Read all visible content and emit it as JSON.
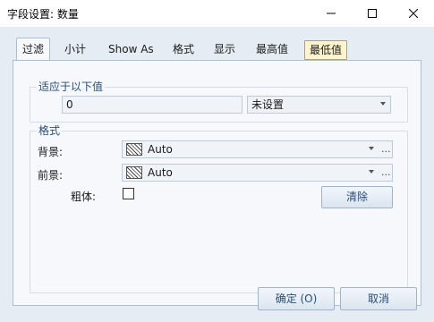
{
  "window": {
    "title": "字段设置: 数量"
  },
  "tabs": [
    {
      "label": "过滤"
    },
    {
      "label": "小计"
    },
    {
      "label": "Show As"
    },
    {
      "label": "格式"
    },
    {
      "label": "显示"
    },
    {
      "label": "最高值"
    },
    {
      "label": "最低值"
    }
  ],
  "selected_tab": "最低值",
  "apply_group": {
    "legend": "适应于以下值",
    "value_input": "0",
    "condition_select": "未设置"
  },
  "format_group": {
    "legend": "格式",
    "background_label": "背景:",
    "background_value": "Auto",
    "foreground_label": "前景:",
    "foreground_value": "Auto",
    "bold_label": "粗体:",
    "bold_checked": false,
    "clear_button": "清除",
    "ellipsis": "..."
  },
  "footer": {
    "ok_button": "确定 (O)",
    "cancel_button": "取消"
  },
  "colors": {
    "client_bg": "#e6ecf3",
    "panel_bg": "#f6f8fb",
    "accent_text": "#2b4d7a",
    "selected_tab_bg": "#fdf3cd"
  },
  "icons": {
    "minimize": "minimize-icon",
    "maximize": "maximize-icon",
    "close": "close-icon",
    "swatch": "hatched-swatch-icon",
    "dropdown": "chevron-down-icon"
  }
}
